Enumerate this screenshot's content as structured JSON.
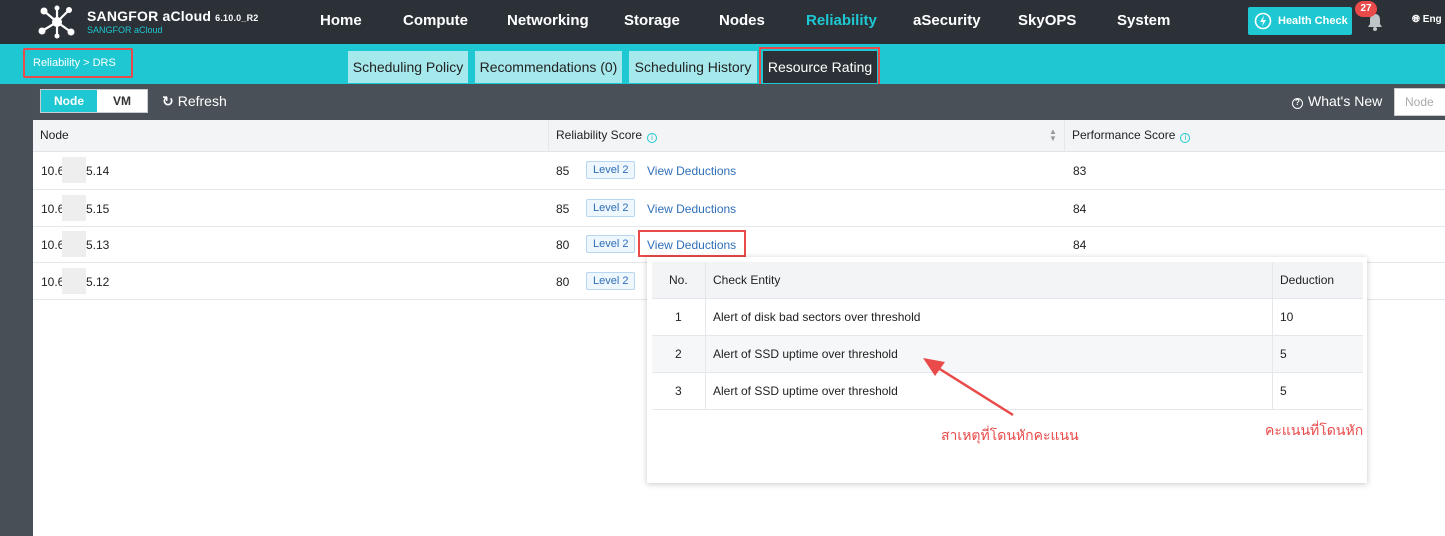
{
  "header": {
    "brand_title": "SANGFOR aCloud",
    "brand_version": "6.10.0_R2",
    "brand_subtitle": "SANGFOR aCloud",
    "nav": [
      "Home",
      "Compute",
      "Networking",
      "Storage",
      "Nodes",
      "Reliability",
      "aSecurity",
      "SkyOPS",
      "System"
    ],
    "active_nav": "Reliability",
    "health_check_label": "Health Check",
    "notification_count": "27",
    "language_label": "Eng"
  },
  "breadcrumb": "Reliability  > DRS",
  "tabs": [
    "Scheduling Policy",
    "Recommendations (0)",
    "Scheduling History",
    "Resource Rating"
  ],
  "active_tab": "Resource Rating",
  "toolbar": {
    "node_toggle": "Node",
    "vm_toggle": "VM",
    "refresh_label": "Refresh",
    "whats_new_label": "What's New",
    "search_placeholder": "Node"
  },
  "table": {
    "columns": [
      "Node",
      "Reliability Score",
      "Performance Score"
    ],
    "rows": [
      {
        "node_prefix": "10.6",
        "node_suffix": "5.14",
        "reliability": "85",
        "level": "Level 2",
        "link": "View Deductions",
        "performance": "83"
      },
      {
        "node_prefix": "10.6",
        "node_suffix": "5.15",
        "reliability": "85",
        "level": "Level 2",
        "link": "View Deductions",
        "performance": "84"
      },
      {
        "node_prefix": "10.6",
        "node_suffix": "5.13",
        "reliability": "80",
        "level": "Level 2",
        "link": "View Deductions",
        "performance": "84"
      },
      {
        "node_prefix": "10.6",
        "node_suffix": "5.12",
        "reliability": "80",
        "level": "Level 2",
        "link": "",
        "performance": ""
      }
    ]
  },
  "deductions_popup": {
    "columns": [
      "No.",
      "Check Entity",
      "Deduction"
    ],
    "rows": [
      {
        "no": "1",
        "entity": "Alert of disk bad sectors over threshold",
        "deduction": "10"
      },
      {
        "no": "2",
        "entity": "Alert of SSD uptime over threshold",
        "deduction": "5"
      },
      {
        "no": "3",
        "entity": "Alert of SSD uptime over threshold",
        "deduction": "5"
      }
    ]
  },
  "annotations": {
    "reason_label": "สาเหตุที่โดนหักคะแนน",
    "points_label": "คะแนนที่โดนหัก"
  },
  "colors": {
    "accent": "#1ec8d2",
    "topbar": "#2b3137",
    "annotation_red": "#e94a4a",
    "link_blue": "#2f6fb8"
  }
}
